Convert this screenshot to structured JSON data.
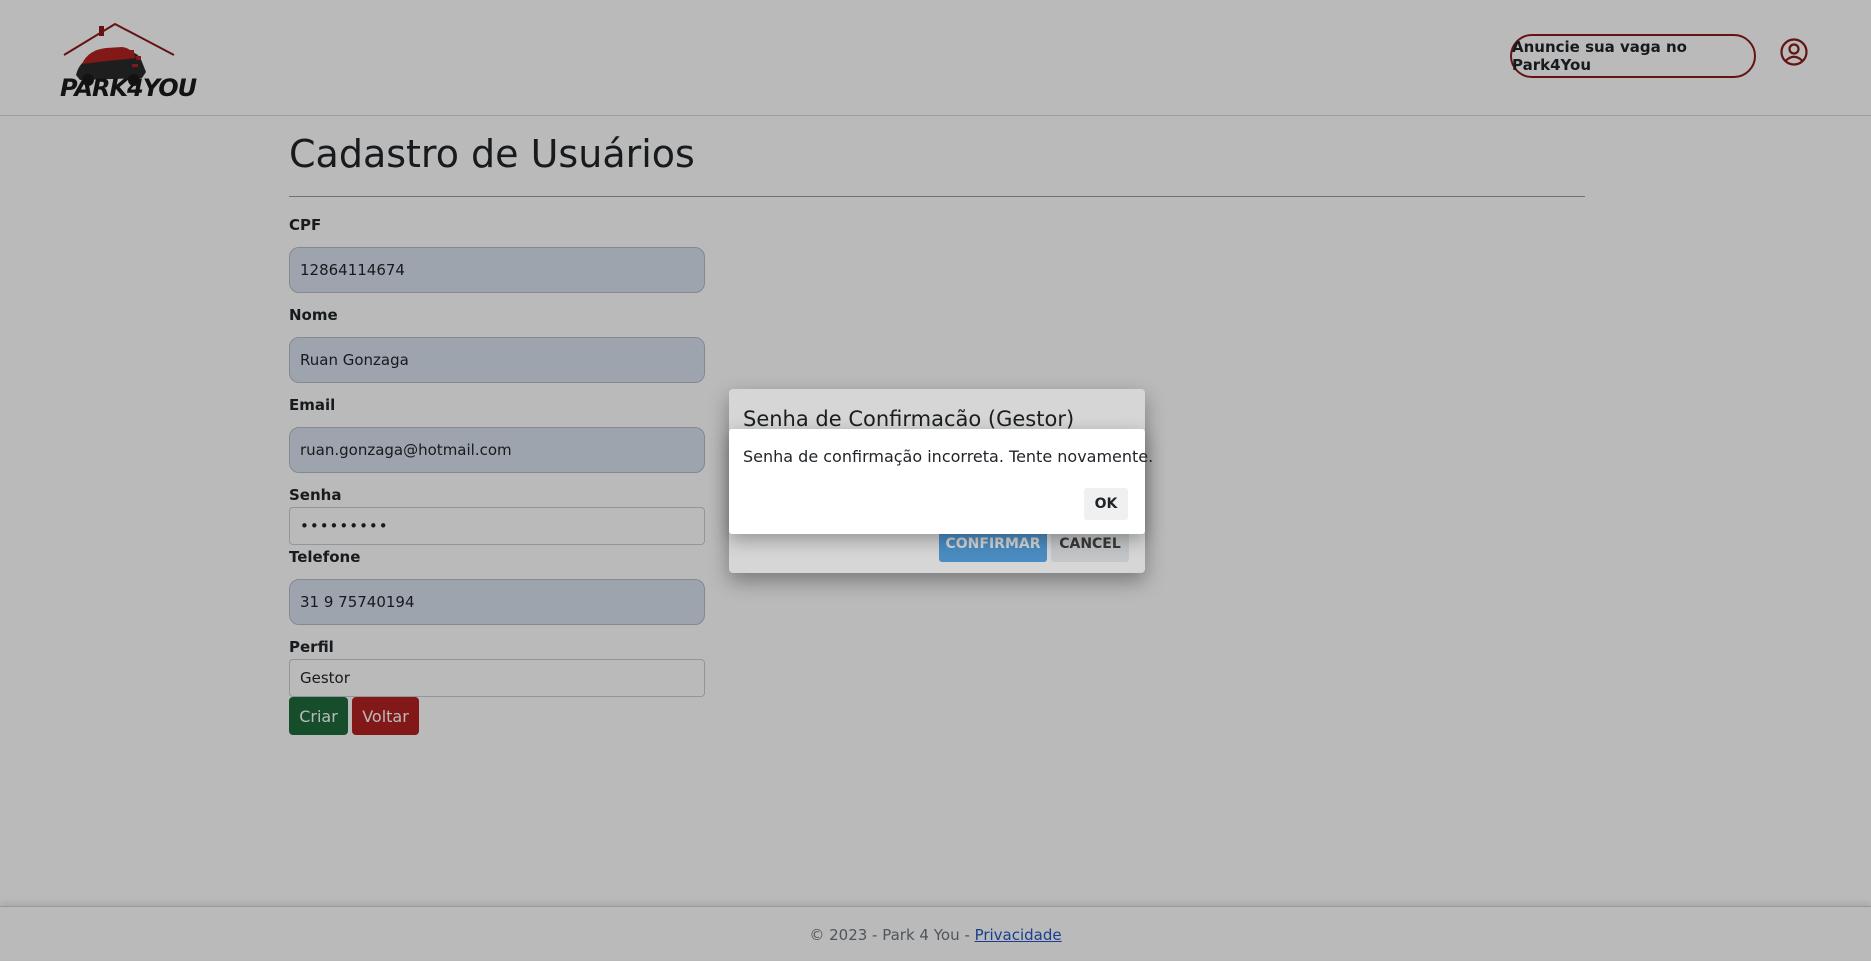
{
  "header": {
    "logo_text": "PARK4YOU",
    "cta_label": "Anuncie sua vaga no Park4You",
    "user_icon": "user-circle-icon"
  },
  "main": {
    "title": "Cadastro de Usuários",
    "fields": {
      "cpf": {
        "label": "CPF",
        "value": "12864114674"
      },
      "nome": {
        "label": "Nome",
        "value": "Ruan Gonzaga"
      },
      "email": {
        "label": "Email",
        "value": "ruan.gonzaga@hotmail.com"
      },
      "senha": {
        "label": "Senha",
        "value": "•••••••••"
      },
      "telefone": {
        "label": "Telefone",
        "value": "31 9 75740194"
      },
      "perfil": {
        "label": "Perfil",
        "value": "Gestor"
      }
    },
    "buttons": {
      "criar": "Criar",
      "voltar": "Voltar"
    }
  },
  "footer": {
    "text": "© 2023 - Park 4 You - ",
    "link": "Privacidade"
  },
  "confirm_dialog": {
    "title": "Senha de Confirmacão (Gestor)",
    "confirm_label": "CONFIRMAR",
    "cancel_label": "CANCEL"
  },
  "alert_dialog": {
    "message": "Senha de confirmação incorreta. Tente novamente.",
    "ok_label": "OK"
  },
  "colors": {
    "brand_red": "#8b1a1a",
    "criar_green": "#1f6b3b",
    "voltar_red": "#b22222",
    "confirm_blue": "#5aa8e8",
    "link_blue": "#2457c5"
  }
}
